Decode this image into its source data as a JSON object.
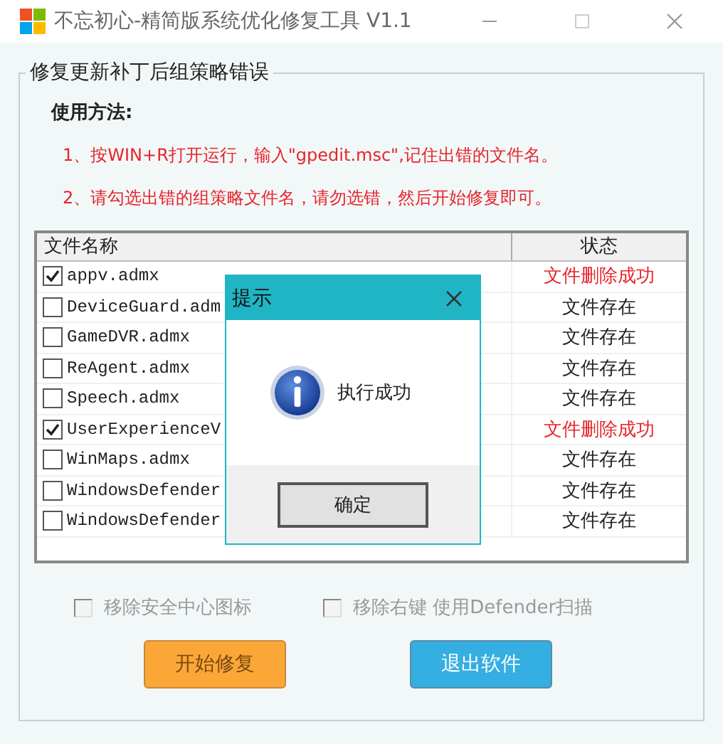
{
  "window": {
    "title": "不忘初心-精简版系统优化修复工具 V1.1"
  },
  "group": {
    "title": "修复更新补丁后组策略错误",
    "usage_heading": "使用方法:",
    "steps": [
      "1、按WIN+R打开运行，输入\"gpedit.msc\",记住出错的文件名。",
      "2、请勾选出错的组策略文件名，请勿选错，然后开始修复即可。"
    ],
    "table": {
      "columns": [
        "文件名称",
        "状态"
      ],
      "rows": [
        {
          "name": "appv.admx",
          "checked": true,
          "status": "文件删除成功",
          "color": "#e8232b"
        },
        {
          "name": "DeviceGuard.adm",
          "checked": false,
          "status": "文件存在",
          "color": "#222222"
        },
        {
          "name": "GameDVR.admx",
          "checked": false,
          "status": "文件存在",
          "color": "#222222"
        },
        {
          "name": "ReAgent.admx",
          "checked": false,
          "status": "文件存在",
          "color": "#222222"
        },
        {
          "name": "Speech.admx",
          "checked": false,
          "status": "文件存在",
          "color": "#222222"
        },
        {
          "name": "UserExperienceV",
          "checked": true,
          "status": "文件删除成功",
          "color": "#e8232b"
        },
        {
          "name": "WinMaps.admx",
          "checked": false,
          "status": "文件存在",
          "color": "#222222"
        },
        {
          "name": "WindowsDefender",
          "checked": false,
          "status": "文件存在",
          "color": "#222222"
        },
        {
          "name": "WindowsDefender",
          "checked": false,
          "status": "文件存在",
          "color": "#222222"
        }
      ]
    },
    "options": [
      {
        "label": "移除安全中心图标",
        "checked": false,
        "disabled": true
      },
      {
        "label": "移除右键 使用Defender扫描",
        "checked": false,
        "disabled": true
      }
    ],
    "buttons": [
      {
        "label": "开始修复",
        "kind": "start"
      },
      {
        "label": "退出软件",
        "kind": "exit"
      }
    ]
  },
  "dialog": {
    "title": "提示",
    "message": "执行成功",
    "button": "确定"
  }
}
